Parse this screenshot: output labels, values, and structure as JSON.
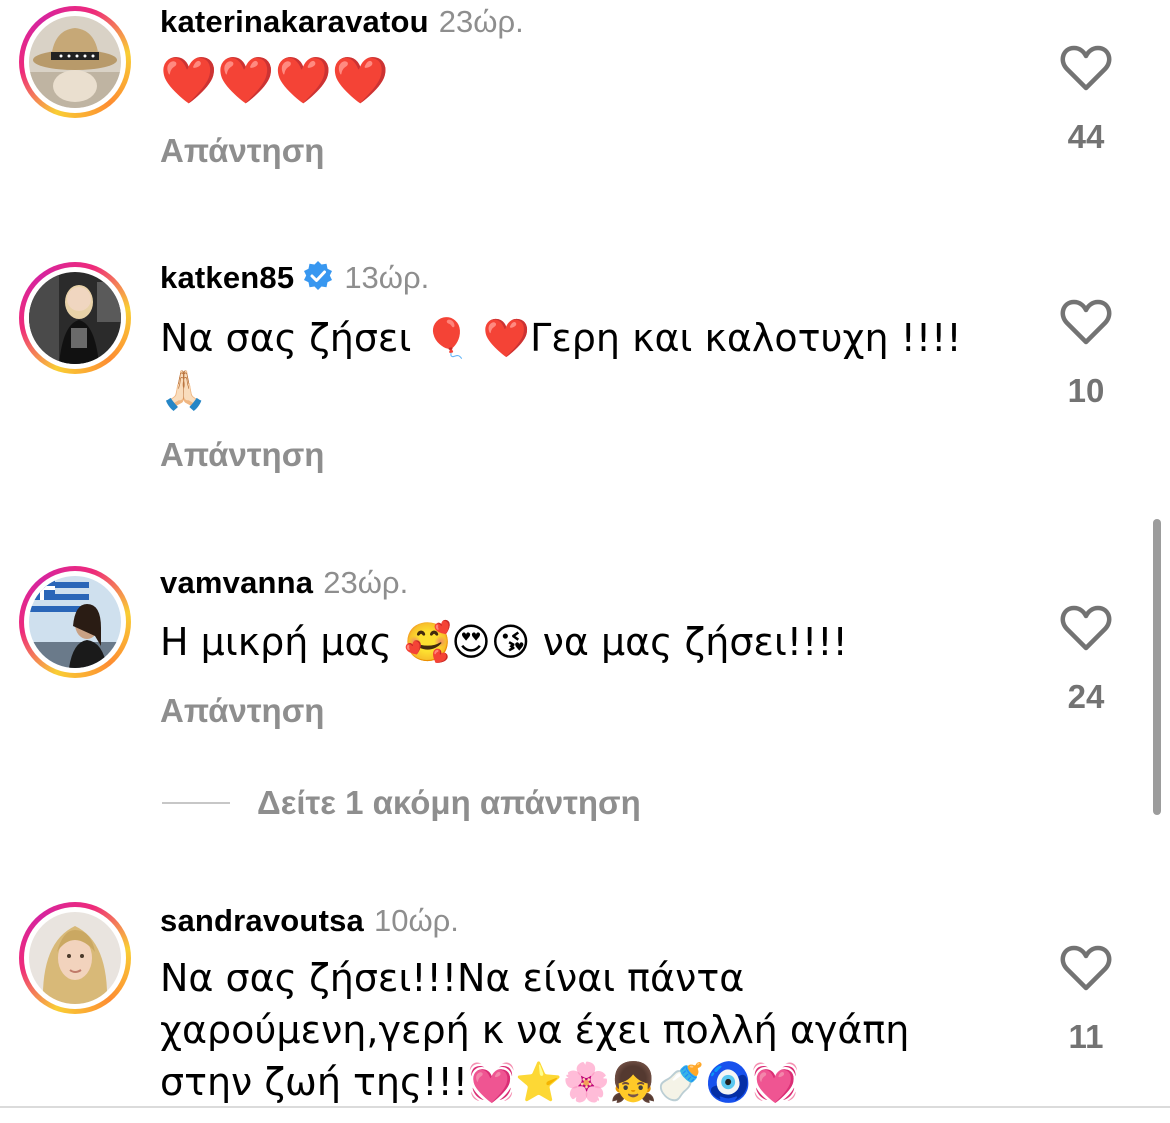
{
  "colors": {
    "muted_text": "#8e8e8e",
    "like_count": "#737373",
    "verified_badge": "#3897f0",
    "ring_gradient": [
      "#f9ce34",
      "#ee2a7b",
      "#d6249f",
      "#fd8d32"
    ]
  },
  "comments": [
    {
      "username": "katerinakaravatou",
      "time": "23ώρ.",
      "verified": false,
      "text": "❤️❤️❤️❤️",
      "reply_label": "Απάντηση",
      "likes": "44",
      "like_icon": "heart-outline-icon",
      "avatar_icon": "avatar-straw-hat"
    },
    {
      "username": "katken85",
      "time": "13ώρ.",
      "verified": true,
      "verified_icon": "verified-badge-icon",
      "text": "Να σας ζήσει 🎈 ❤️Γερη και καλοτυχη !!!! 🙏🏻",
      "reply_label": "Απάντηση",
      "likes": "10",
      "like_icon": "heart-outline-icon",
      "avatar_icon": "avatar-blonde-dark-room"
    },
    {
      "username": "vamvanna",
      "time": "23ώρ.",
      "verified": false,
      "text": "Η μικρή μας 🥰😍😘 να μας ζήσει!!!!",
      "reply_label": "Απάντηση",
      "likes": "24",
      "like_icon": "heart-outline-icon",
      "avatar_icon": "avatar-greek-flag"
    },
    {
      "username": "sandravoutsa",
      "time": "10ώρ.",
      "verified": false,
      "text": "Να σας ζήσει!!!Να είναι πάντα χαρούμενη,γερή κ να έχει πολλή αγάπη στην ζωή της!!!💓⭐🌸👧🍼🧿💓",
      "reply_label": "Απάντηση",
      "likes": "11",
      "like_icon": "heart-outline-icon",
      "avatar_icon": "avatar-blonde-hair"
    }
  ],
  "more_replies": "Δείτε 1 ακόμη απάντηση"
}
